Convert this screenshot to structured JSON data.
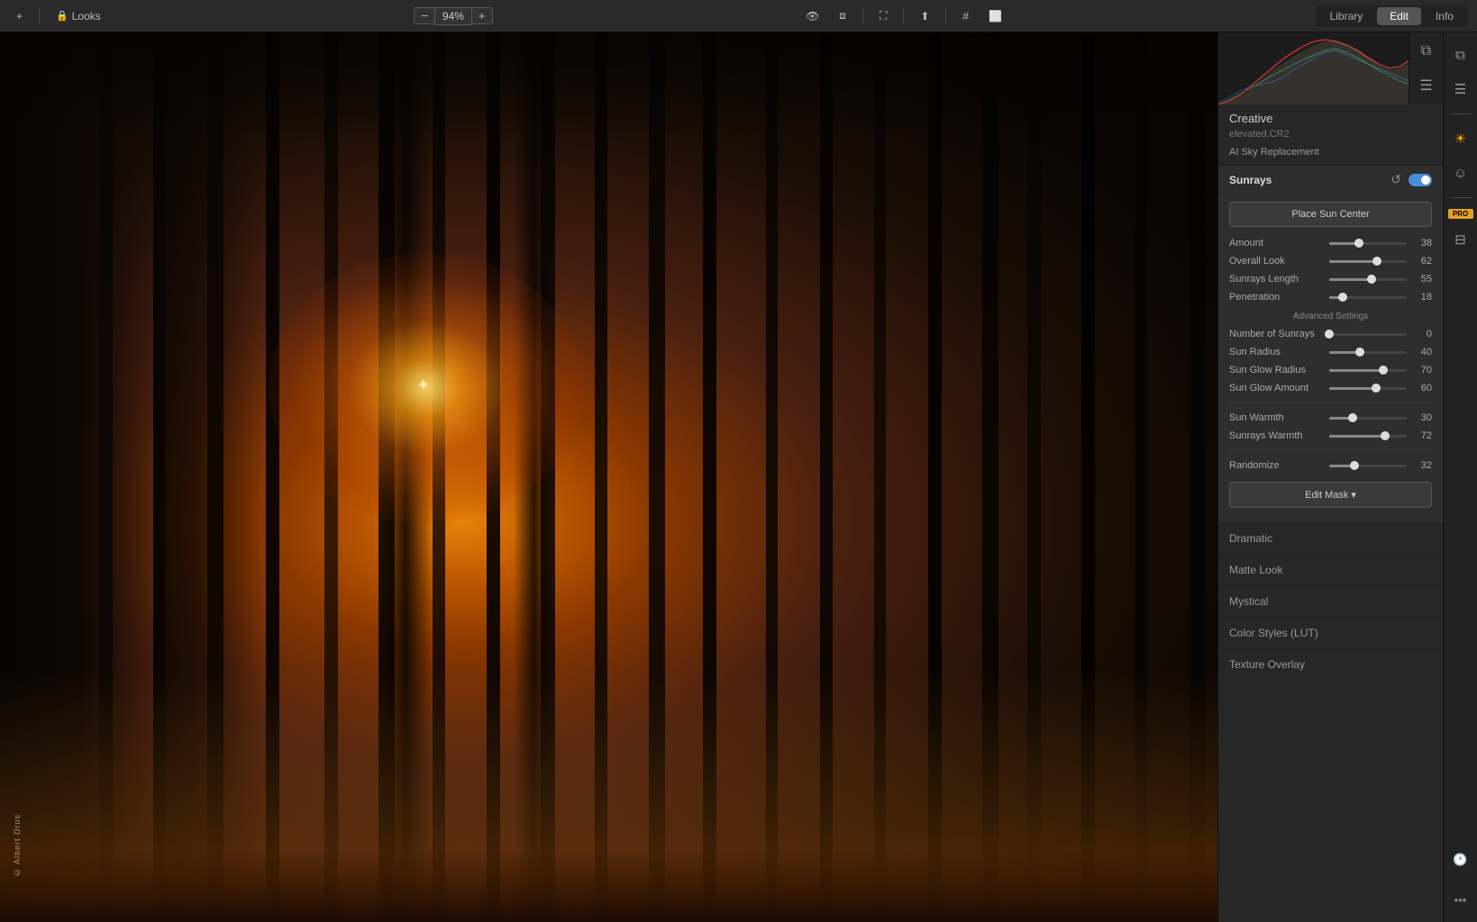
{
  "toolbar": {
    "add_label": "+",
    "looks_label": "Looks",
    "zoom_value": "94%",
    "zoom_minus": "−",
    "zoom_plus": "+",
    "tabs": {
      "library": "Library",
      "edit": "Edit",
      "info": "Info"
    },
    "active_tab": "Edit"
  },
  "histogram": {
    "title": "Histogram"
  },
  "panel": {
    "section_title": "Creative",
    "filename": "elevated.CR2",
    "feature_label": "AI Sky Replacement",
    "sunrays": {
      "title": "Sunrays",
      "place_sun_btn": "Place Sun Center",
      "sliders": [
        {
          "label": "Amount",
          "value": 38,
          "percent": 38
        },
        {
          "label": "Overall Look",
          "value": 62,
          "percent": 62
        },
        {
          "label": "Sunrays Length",
          "value": 55,
          "percent": 55
        },
        {
          "label": "Penetration",
          "value": 18,
          "percent": 18
        }
      ],
      "advanced_settings_label": "Advanced Settings",
      "advanced_sliders": [
        {
          "label": "Number of Sunrays",
          "value": 0,
          "percent": 0
        },
        {
          "label": "Sun Radius",
          "value": 40,
          "percent": 40
        },
        {
          "label": "Sun Glow Radius",
          "value": 70,
          "percent": 70
        },
        {
          "label": "Sun Glow Amount",
          "value": 60,
          "percent": 60
        },
        {
          "label": "Sun Warmth",
          "value": 30,
          "percent": 30
        },
        {
          "label": "Sunrays Warmth",
          "value": 72,
          "percent": 72
        },
        {
          "label": "Randomize",
          "value": 32,
          "percent": 32
        }
      ],
      "edit_mask_btn": "Edit Mask ▾"
    },
    "creative_items": [
      "Dramatic",
      "Matte Look",
      "Mystical",
      "Color Styles (LUT)",
      "Texture Overlay"
    ]
  },
  "watermark": "© Albert Dros",
  "side_icons": [
    {
      "name": "layers-icon",
      "symbol": "⧉"
    },
    {
      "name": "sliders-icon",
      "symbol": "≡"
    },
    {
      "name": "sun-tool-icon",
      "symbol": "☀",
      "active": true
    },
    {
      "name": "face-icon",
      "symbol": "☺"
    },
    {
      "name": "pro-badge",
      "text": "PRO"
    },
    {
      "name": "bag-icon",
      "symbol": "⊟"
    }
  ]
}
